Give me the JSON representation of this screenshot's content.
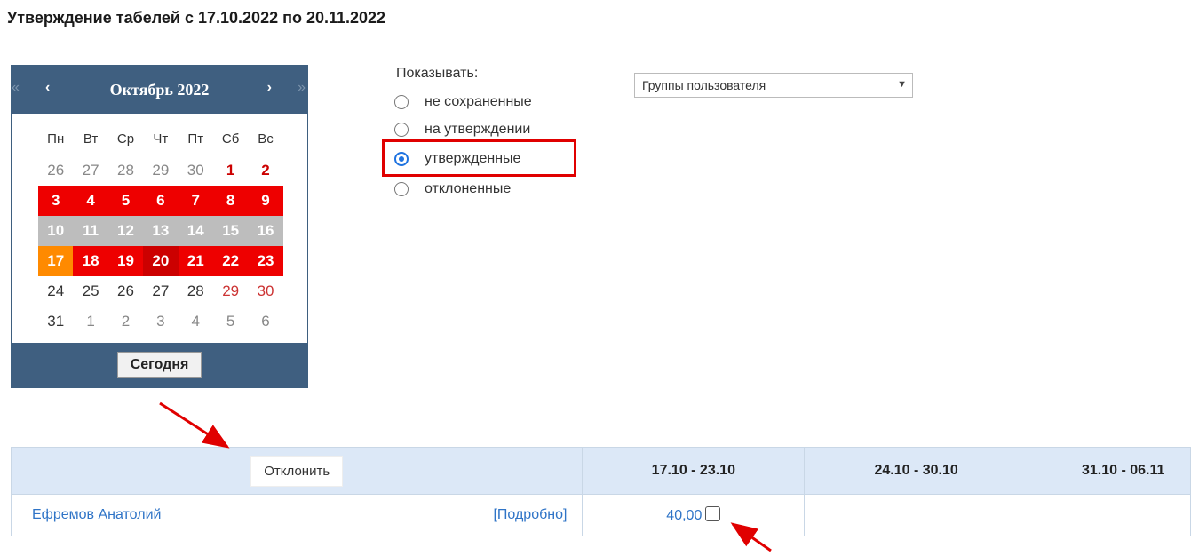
{
  "page": {
    "title": "Утверждение табелей с 17.10.2022 по 20.11.2022"
  },
  "calendar": {
    "title": "Октябрь 2022",
    "nav": {
      "prev_year": "«",
      "prev": "‹",
      "next": "›",
      "next_year": "»"
    },
    "weekdays": [
      "Пн",
      "Вт",
      "Ср",
      "Чт",
      "Пт",
      "Сб",
      "Вс"
    ],
    "weeks": [
      [
        "26",
        "27",
        "28",
        "29",
        "30",
        "1",
        "2"
      ],
      [
        "3",
        "4",
        "5",
        "6",
        "7",
        "8",
        "9"
      ],
      [
        "10",
        "11",
        "12",
        "13",
        "14",
        "15",
        "16"
      ],
      [
        "17",
        "18",
        "19",
        "20",
        "21",
        "22",
        "23"
      ],
      [
        "24",
        "25",
        "26",
        "27",
        "28",
        "29",
        "30"
      ],
      [
        "31",
        "1",
        "2",
        "3",
        "4",
        "5",
        "6"
      ]
    ],
    "today_label": "Сегодня",
    "colors": {
      "header": "#3f5f80",
      "selected": "#ee0000",
      "today": "#ff8a00",
      "grey": "#bdbdbd"
    }
  },
  "filter": {
    "label": "Показывать:",
    "options": [
      "не сохраненные",
      "на утверждении",
      "утвержденные",
      "отклоненные"
    ],
    "selected": "утвержденные",
    "group_select": "Группы пользователя"
  },
  "table": {
    "reject_label": "Отклонить",
    "columns": [
      "17.10 - 23.10",
      "24.10 - 30.10",
      "31.10 - 06.11"
    ],
    "rows": [
      {
        "name": "Ефремов Анатолий",
        "details": "[Подробно]",
        "hours": "40,00"
      }
    ]
  }
}
